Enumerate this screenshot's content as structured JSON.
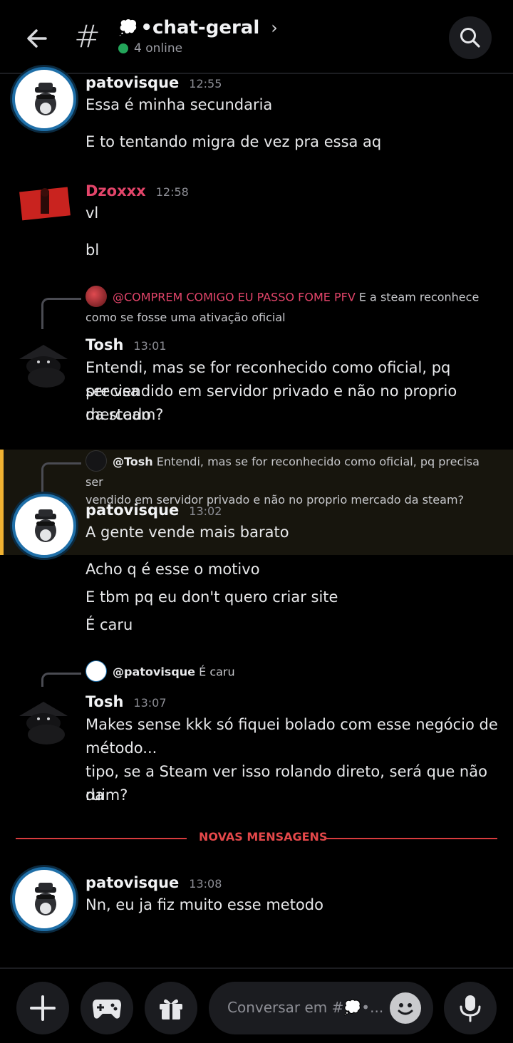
{
  "header": {
    "channel_emoji": "💭",
    "channel_name": "•chat-geral",
    "online_count": "4 online"
  },
  "messages": [
    {
      "username": "patovisque",
      "time": "12:55",
      "lines": [
        "Essa é minha secundaria",
        "E to tentando migra de vez pra essa aq"
      ]
    },
    {
      "username": "Dzoxxx",
      "time": "12:58",
      "lines": [
        "vl",
        "bl"
      ]
    },
    {
      "reply_mention": "@COMPREM COMIGO EU PASSO FOME PFV",
      "reply_text_1": " E a steam reconhece",
      "reply_text_2": "como se fosse uma ativação oficial",
      "username": "Tosh",
      "time": "13:01",
      "lines": [
        "Entendi, mas se for reconhecido como oficial, pq precisa",
        "ser vendido em servidor privado e não no proprio mercado",
        "da steam?"
      ]
    },
    {
      "reply_mention": "@Tosh",
      "reply_text_1": " Entendi, mas se for reconhecido como oficial, pq precisa ser",
      "reply_text_2": "vendido em servidor privado e não no proprio mercado da steam?",
      "username": "patovisque",
      "time": "13:02",
      "lines": [
        "A gente vende mais barato",
        "Acho q é esse o motivo",
        "E tbm pq eu don't quero criar site",
        "É caru"
      ]
    },
    {
      "reply_mention": "@patovisque",
      "reply_text_1": " É caru",
      "username": "Tosh",
      "time": "13:07",
      "lines": [
        "Makes sense kkk só fiquei bolado com esse negócio de",
        "método...",
        "tipo, se a Steam ver isso rolando direto, será que não da",
        "ruim?"
      ]
    },
    {
      "username": "patovisque",
      "time": "13:08",
      "lines": [
        "Nn, eu ja fiz muito esse metodo"
      ]
    }
  ],
  "divider_label": "NOVAS MENSAGENS",
  "composer": {
    "placeholder": "Conversar em #💭•..."
  },
  "colors": {
    "accent_red": "#d83c3e",
    "mention_pink": "#e3456a",
    "highlight_bar": "#f0b232",
    "online_green": "#23a55a"
  },
  "icons": [
    "back-arrow-icon",
    "hash-icon",
    "chevron-right-icon",
    "search-icon",
    "plus-icon",
    "gamepad-icon",
    "gift-icon",
    "emoji-icon",
    "microphone-icon"
  ]
}
